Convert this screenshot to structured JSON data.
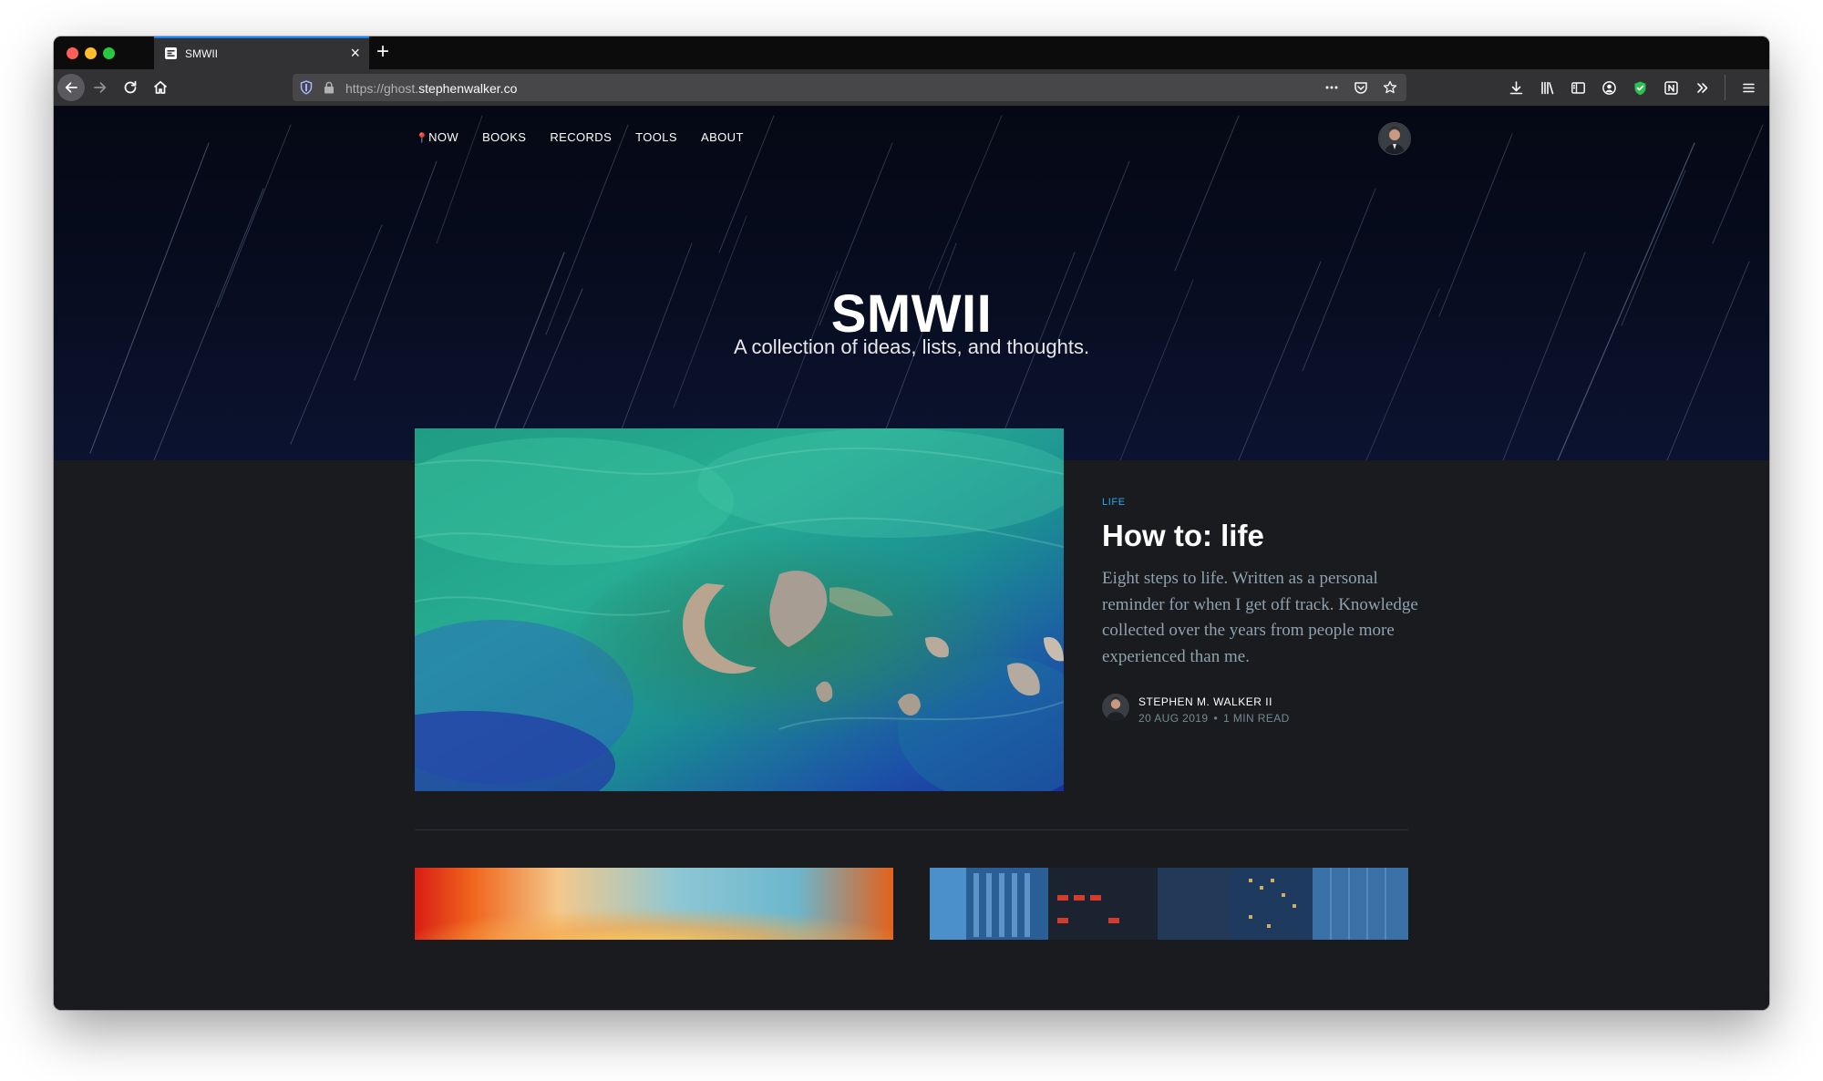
{
  "browser": {
    "tab": {
      "title": "SMWII"
    },
    "url": {
      "scheme": "https://ghost.",
      "domain": "stephenwalker.co"
    }
  },
  "site": {
    "nav": [
      {
        "label": "NOW"
      },
      {
        "label": "BOOKS"
      },
      {
        "label": "RECORDS"
      },
      {
        "label": "TOOLS"
      },
      {
        "label": "ABOUT"
      }
    ],
    "title": "SMWII",
    "description": "A collection of ideas, lists, and thoughts."
  },
  "featured_post": {
    "tag": "LIFE",
    "title": "How to: life",
    "excerpt": "Eight steps to life. Written as a personal reminder for when I get off track. Knowledge collected over the years from people more experienced than me.",
    "author": "STEPHEN M. WALKER II",
    "date": "20 AUG 2019",
    "reading_time": "1 MIN READ"
  },
  "colors": {
    "accent_tag": "#26a8ed",
    "page_bg": "#191b1f",
    "hero_bg": "#070c1e",
    "excerpt": "#90a2ae",
    "chrome": "#323234"
  }
}
